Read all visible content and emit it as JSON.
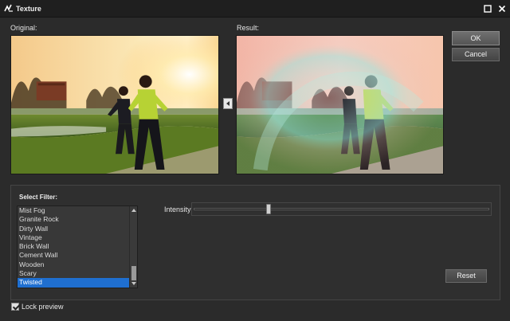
{
  "window": {
    "title": "Texture",
    "icons": {
      "app": "app-logo-icon",
      "maximize": "maximize-icon",
      "close": "close-icon"
    }
  },
  "labels": {
    "original": "Original:",
    "result": "Result:"
  },
  "buttons": {
    "ok": "OK",
    "cancel": "Cancel",
    "reset": "Reset",
    "copy_icon": "arrow-left-icon"
  },
  "filter": {
    "heading": "Select Filter:",
    "items": [
      {
        "label": "Mist Fog",
        "selected": false
      },
      {
        "label": "Granite Rock",
        "selected": false
      },
      {
        "label": "Dirty Wall",
        "selected": false
      },
      {
        "label": "Vintage",
        "selected": false
      },
      {
        "label": "Brick Wall",
        "selected": false
      },
      {
        "label": "Cement Wall",
        "selected": false
      },
      {
        "label": "Wooden",
        "selected": false
      },
      {
        "label": "Scary",
        "selected": false
      },
      {
        "label": "Twisted",
        "selected": true
      }
    ]
  },
  "intensity": {
    "label": "Intensity:",
    "value_fraction": 0.25
  },
  "lock_preview": {
    "label": "Lock preview",
    "checked": true
  },
  "colors": {
    "accent": "#1f6fd0",
    "background": "#2b2b2b",
    "titlebar": "#1f1f1f"
  }
}
